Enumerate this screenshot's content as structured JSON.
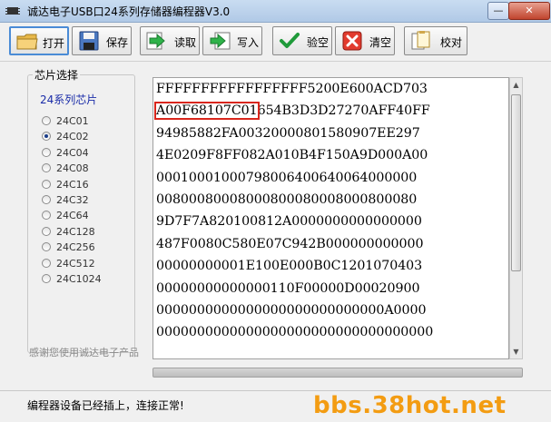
{
  "window": {
    "title": "诚达电子USB口24系列存储器编程器V3.0",
    "minimize": "—",
    "close": "✕"
  },
  "toolbar": [
    {
      "name": "open-button",
      "icon": "folder-icon",
      "label": "打开"
    },
    {
      "name": "save-button",
      "icon": "floppy-icon",
      "label": "保存"
    },
    {
      "name": "read-button",
      "icon": "arrow-in-icon",
      "label": "读取"
    },
    {
      "name": "write-button",
      "icon": "arrow-out-icon",
      "label": "写入"
    },
    {
      "name": "verify-empty-button",
      "icon": "checkmark-icon",
      "label": "验空"
    },
    {
      "name": "clear-button",
      "icon": "cross-icon",
      "label": "清空"
    },
    {
      "name": "compare-button",
      "icon": "documents-icon",
      "label": "校对"
    }
  ],
  "chip_select": {
    "legend": "芯片选择",
    "series_label": "24系列芯片",
    "options": [
      "24C01",
      "24C02",
      "24C04",
      "24C08",
      "24C16",
      "24C32",
      "24C64",
      "24C128",
      "24C256",
      "24C512",
      "24C1024"
    ],
    "selected": "24C02"
  },
  "thanks_text": "感谢您使用诚达电子产品",
  "hex": {
    "lines": [
      "FFFFFFFFFFFFFFFFF5200E600ACD703",
      "A00F68107C01654B3D3D27270AFF40FF",
      "94985882FA00320000801580907EE297",
      "4E0209F8FF082A010B4F150A9D000A00",
      "00010001000798006400640064000000",
      "00800080008000800080008000800080",
      "9D7F7A820100812A0000000000000000",
      "487F0080C580E07C942B000000000000",
      "00000000001E100E000B0C1201070403",
      "00000000000000110F00000D00020900",
      "0000000000000000000000000000A0000",
      "0000000000000000000000000000000000"
    ],
    "highlight": "A00F68107C01",
    "highlight_rest": "654B3D3D27270AFF40FF"
  },
  "status": {
    "text": "编程器设备已经插上，连接正常!"
  },
  "watermark": "bbs.38hot.net",
  "colors": {
    "highlight_border": "#d9261c",
    "series_label": "#1a2ca8",
    "watermark": "#f39c12"
  }
}
